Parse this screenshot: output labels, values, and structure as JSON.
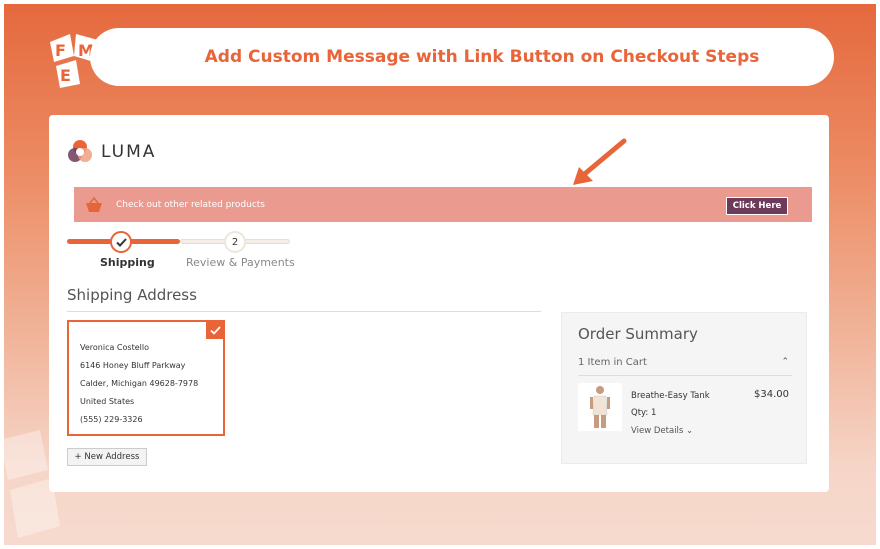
{
  "header": {
    "title": "Add Custom Message with Link Button on Checkout Steps",
    "logo_letters": [
      "F",
      "M",
      "E"
    ]
  },
  "store": {
    "name": "LUMA"
  },
  "banner": {
    "message": "Check out other related products",
    "button_label": "Click Here",
    "bg_color": "#ea9a8e",
    "button_color": "#6d3b5a"
  },
  "progress": {
    "step1_label": "Shipping",
    "step2_label": "Review & Payments",
    "step2_number": "2",
    "accent": "#e8653a"
  },
  "shipping": {
    "title": "Shipping Address",
    "address_lines": [
      "Veronica Costello",
      "6146 Honey Bluff Parkway",
      "Calder, Michigan 49628-7978",
      "United States",
      "(555) 229-3326"
    ],
    "new_address_label": "+ New Address"
  },
  "summary": {
    "title": "Order Summary",
    "cart_count": "1 Item in Cart",
    "item": {
      "name": "Breathe-Easy Tank",
      "price": "$34.00",
      "qty": "Qty: 1",
      "view_details": "View Details"
    }
  }
}
